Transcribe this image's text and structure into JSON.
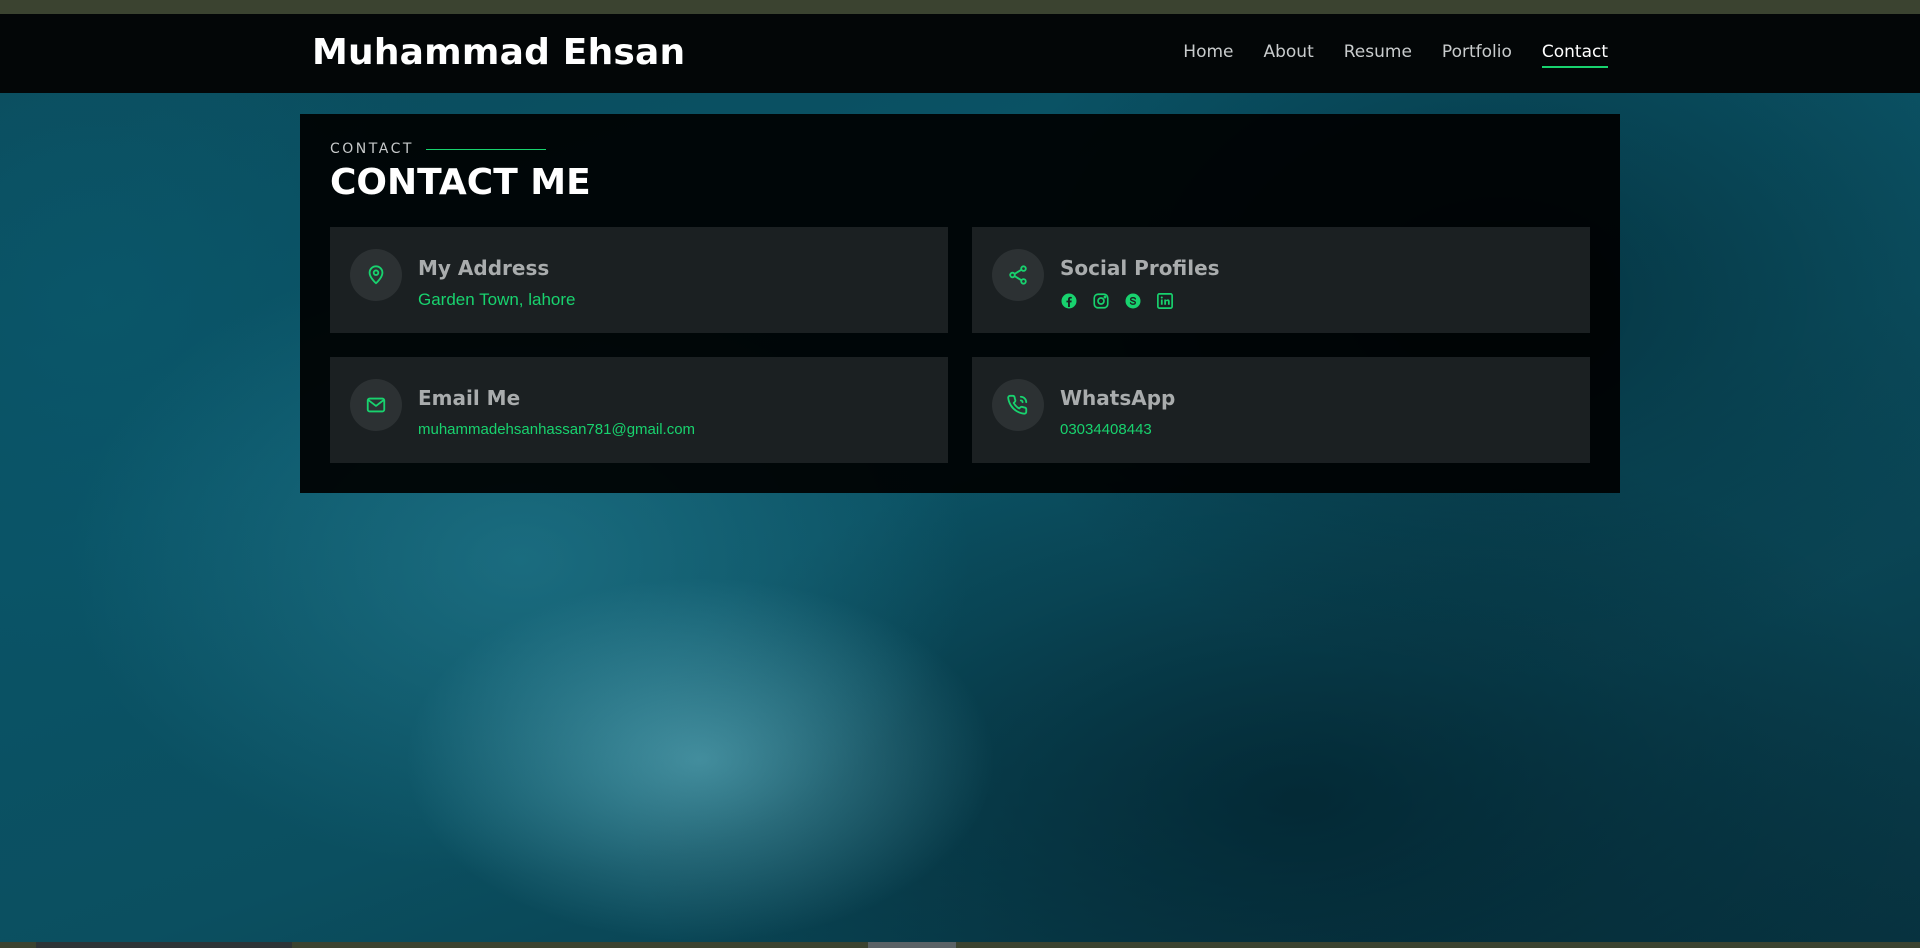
{
  "header": {
    "brand": "Muhammad Ehsan",
    "nav": [
      "Home",
      "About",
      "Resume",
      "Portfolio",
      "Contact"
    ],
    "active": "Contact"
  },
  "section": {
    "label": "CONTACT",
    "title": "CONTACT ME"
  },
  "cards": {
    "address": {
      "title": "My Address",
      "value": "Garden Town, lahore",
      "icon": "map-pin-icon"
    },
    "social": {
      "title": "Social Profiles",
      "icons": [
        "facebook-icon",
        "instagram-icon",
        "skype-icon",
        "linkedin-icon"
      ]
    },
    "email": {
      "title": "Email Me",
      "value": "muhammadehsanhassan781@gmail.com",
      "icon": "envelope-icon"
    },
    "whatsapp": {
      "title": "WhatsApp",
      "value": "03034408443",
      "icon": "phone-call-icon"
    }
  },
  "colors": {
    "accent": "#18d26e",
    "header_bg": "#030607",
    "panel_bg": "#000000",
    "card_bg": "#1b2022"
  }
}
